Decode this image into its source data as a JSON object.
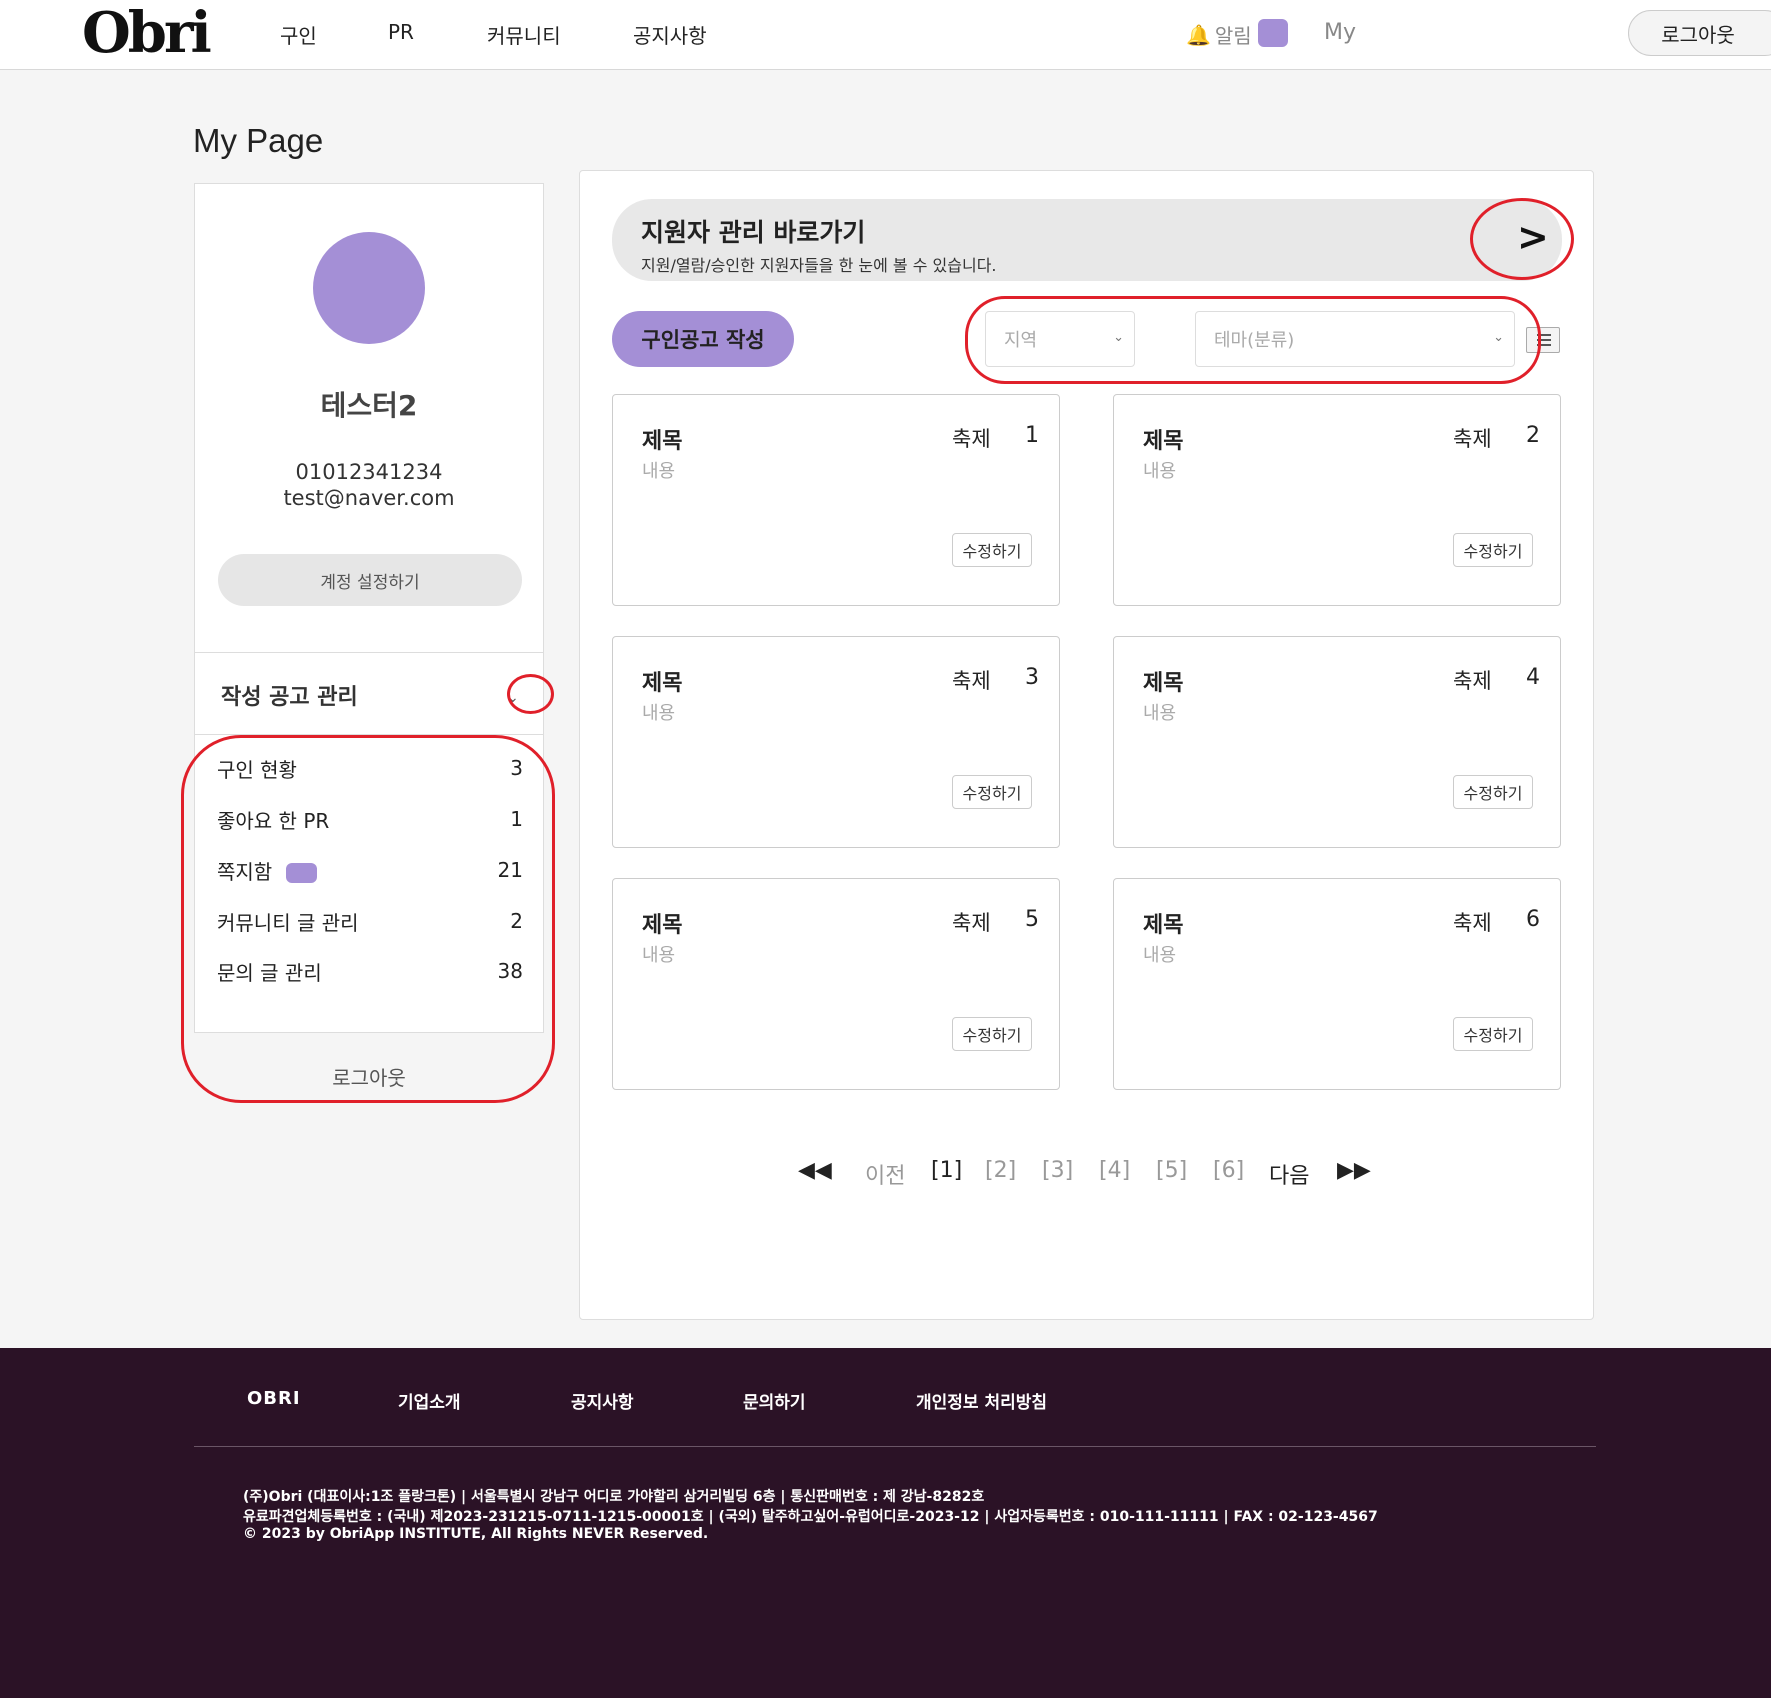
{
  "header": {
    "logo": "Obri",
    "nav": [
      "구인",
      "PR",
      "커뮤니티",
      "공지사항"
    ],
    "alarm_label": "알림",
    "my_label": "My",
    "logout_label": "로그아웃"
  },
  "page": {
    "title": "My Page"
  },
  "profile": {
    "name": "테스터2",
    "phone": "01012341234",
    "email": "test@naver.com",
    "account_button": "계정 설정하기"
  },
  "manage": {
    "title": "작성 공고 관리",
    "items": [
      {
        "label": "구인 현황",
        "count": "3"
      },
      {
        "label": "좋아요 한 PR",
        "count": "1"
      },
      {
        "label": "쪽지함",
        "count": "21"
      },
      {
        "label": "커뮤니티 글 관리",
        "count": "2"
      },
      {
        "label": "문의 글 관리",
        "count": "38"
      }
    ],
    "logout_label": "로그아웃"
  },
  "main": {
    "banner_title": "지원자 관리 바로가기",
    "banner_subtitle": "지원/열람/승인한 지원자들을 한 눈에 볼 수 있습니다.",
    "banner_arrow": ">",
    "write_button": "구인공고 작성",
    "region_select": "지역",
    "theme_select": "테마(분류)",
    "cards": [
      {
        "title": "제목",
        "content": "내용",
        "category": "축제",
        "number": "1",
        "edit": "수정하기"
      },
      {
        "title": "제목",
        "content": "내용",
        "category": "축제",
        "number": "2",
        "edit": "수정하기"
      },
      {
        "title": "제목",
        "content": "내용",
        "category": "축제",
        "number": "3",
        "edit": "수정하기"
      },
      {
        "title": "제목",
        "content": "내용",
        "category": "축제",
        "number": "4",
        "edit": "수정하기"
      },
      {
        "title": "제목",
        "content": "내용",
        "category": "축제",
        "number": "5",
        "edit": "수정하기"
      },
      {
        "title": "제목",
        "content": "내용",
        "category": "축제",
        "number": "6",
        "edit": "수정하기"
      }
    ]
  },
  "pagination": {
    "first": "◀◀",
    "prev": "이전",
    "pages": [
      "[1]",
      "[2]",
      "[3]",
      "[4]",
      "[5]",
      "[6]"
    ],
    "next": "다음",
    "last": "▶▶"
  },
  "footer": {
    "logo": "OBRI",
    "links": [
      "기업소개",
      "공지사항",
      "문의하기",
      "개인정보 처리방침"
    ],
    "line1": "(주)Obri (대표이사:1조 플랑크톤) | 서울특별시 강남구 어디로 가야할리 삼거리빌딩 6층 | 통신판매번호 : 제 강남-8282호",
    "line2": "유료파견업체등록번호 : (국내) 제2023-231215-0711-1215-00001호 | (국외) 탈주하고싶어-유럽어디로-2023-12 | 사업자등록번호 : 010-111-11111 | FAX : 02-123-4567",
    "line3": "© 2023 by ObriApp INSTITUTE, All Rights NEVER Reserved."
  }
}
